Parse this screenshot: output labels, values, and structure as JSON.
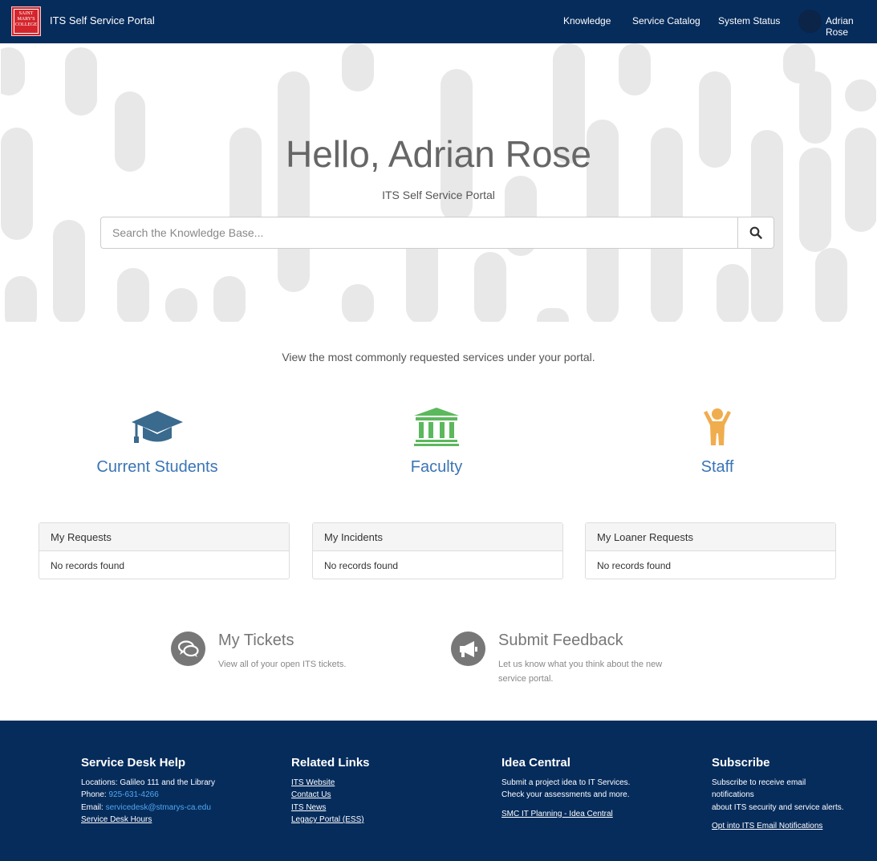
{
  "logo": {
    "line1": "SAINT",
    "line2": "MARY'S",
    "line3": "COLLEGE"
  },
  "brand": "ITS Self Service Portal",
  "nav": {
    "knowledge": "Knowledge",
    "catalog": "Service Catalog",
    "status": "System Status",
    "user": "Adrian Rose"
  },
  "hero": {
    "title": "Hello, Adrian Rose",
    "subtitle": "ITS Self Service Portal",
    "search_placeholder": "Search the Knowledge Base..."
  },
  "intro": "View the most commonly requested services under your portal.",
  "categories": [
    {
      "label": "Current Students",
      "icon": "graduation-cap-icon",
      "color": "#3a6a8e"
    },
    {
      "label": "Faculty",
      "icon": "institution-icon",
      "color": "#5cb85c"
    },
    {
      "label": "Staff",
      "icon": "person-icon",
      "color": "#f0ad4e"
    }
  ],
  "widgets": [
    {
      "title": "My Requests",
      "empty": "No records found"
    },
    {
      "title": "My Incidents",
      "empty": "No records found"
    },
    {
      "title": "My Loaner Requests",
      "empty": "No records found"
    }
  ],
  "actions": [
    {
      "title": "My Tickets",
      "desc": "View all of your open ITS tickets.",
      "icon": "chat-bubbles-icon"
    },
    {
      "title": "Submit Feedback",
      "desc": "Let us know what you think about the new service portal.",
      "icon": "megaphone-icon"
    }
  ],
  "footer": {
    "help": {
      "title": "Service Desk Help",
      "locations": "Locations: Galileo 111 and the Library",
      "phone_label": "Phone:",
      "phone": "925-631-4266",
      "email_label": "Email:",
      "email": "servicedesk@stmarys-ca.edu",
      "hours": "Service Desk Hours"
    },
    "links": {
      "title": "Related Links",
      "items": [
        "ITS Website",
        "Contact Us",
        "ITS News",
        "Legacy Portal (ESS)"
      ]
    },
    "idea": {
      "title": "Idea Central",
      "line1": "Submit a project idea to IT Services.",
      "line2": "Check your assessments and more.",
      "link": "SMC IT Planning - Idea Central"
    },
    "subscribe": {
      "title": "Subscribe",
      "line1": "Subscribe to receive email",
      "line2": "notifications",
      "line3": "about ITS security and service alerts.",
      "link": "Opt into ITS Email Notifications"
    }
  }
}
